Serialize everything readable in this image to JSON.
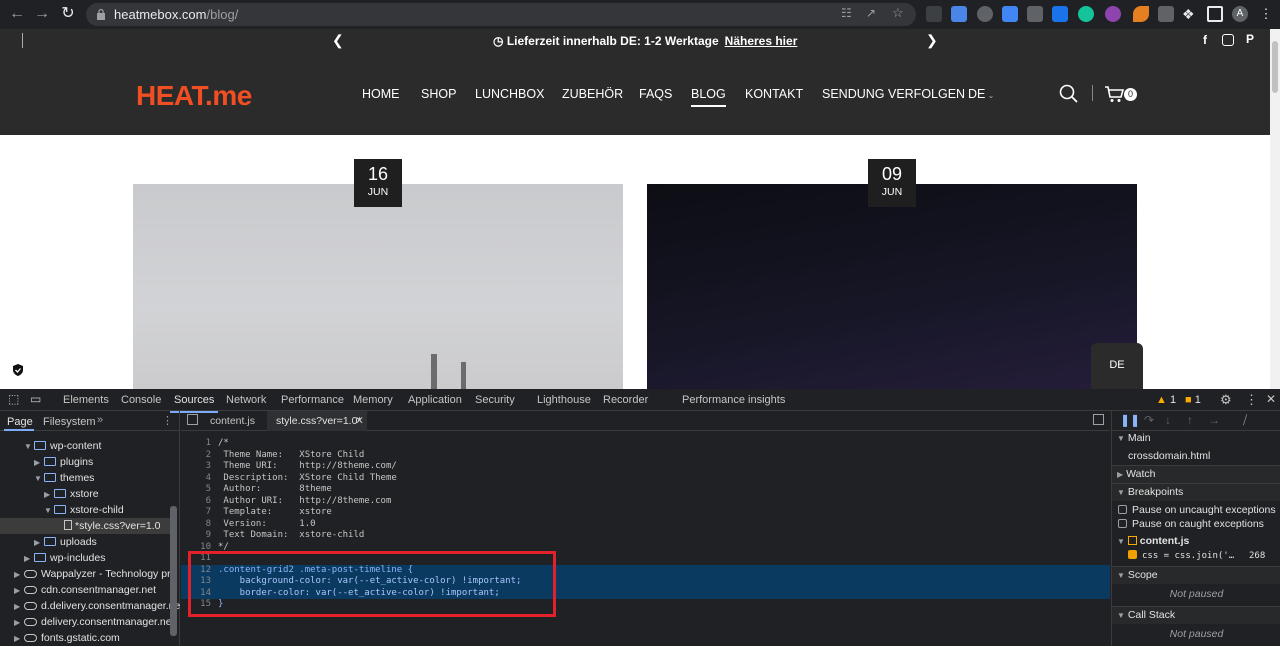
{
  "browser": {
    "url_host": "heatmebox.com",
    "url_path": "/blog/"
  },
  "site": {
    "topbar_message": "Lieferzeit innerhalb DE: 1-2 Werktage",
    "topbar_link": "Näheres hier",
    "logo": "HEAT.me",
    "nav": [
      "HOME",
      "SHOP",
      "LUNCHBOX",
      "ZUBEHÖR",
      "FAQS",
      "BLOG",
      "KONTAKT",
      "SENDUNG VERFOLGEN",
      "DE"
    ],
    "cart_count": "0",
    "posts": [
      {
        "day": "16",
        "month": "JUN"
      },
      {
        "day": "09",
        "month": "JUN"
      }
    ],
    "lang_popup": "DE"
  },
  "devtools": {
    "tabs": [
      "Elements",
      "Console",
      "Sources",
      "Network",
      "Performance",
      "Memory",
      "Application",
      "Security",
      "Lighthouse",
      "Recorder",
      "Performance insights"
    ],
    "warnings": "1",
    "issues": "1",
    "left_tabs": [
      "Page",
      "Filesystem"
    ],
    "tree": [
      {
        "label": "wp-content",
        "type": "folder"
      },
      {
        "label": "plugins",
        "type": "folder"
      },
      {
        "label": "themes",
        "type": "folder"
      },
      {
        "label": "xstore",
        "type": "folder"
      },
      {
        "label": "xstore-child",
        "type": "folder"
      },
      {
        "label": "*style.css?ver=1.0",
        "type": "file"
      },
      {
        "label": "uploads",
        "type": "folder"
      },
      {
        "label": "wp-includes",
        "type": "folder"
      },
      {
        "label": "Wappalyzer - Technology pro",
        "type": "cloud"
      },
      {
        "label": "cdn.consentmanager.net",
        "type": "cloud"
      },
      {
        "label": "d.delivery.consentmanager.ne",
        "type": "cloud"
      },
      {
        "label": "delivery.consentmanager.net",
        "type": "cloud"
      },
      {
        "label": "fonts.gstatic.com",
        "type": "cloud"
      }
    ],
    "editor_tabs": [
      "content.js",
      "style.css?ver=1.0*"
    ],
    "code": [
      "/*",
      " Theme Name:   XStore Child",
      " Theme URI:    http://8theme.com/",
      " Description:  XStore Child Theme",
      " Author:       8theme",
      " Author URI:   http://8theme.com",
      " Template:     xstore",
      " Version:      1.0",
      " Text Domain:  xstore-child",
      "*/",
      "",
      ".content-grid2 .meta-post-timeline {",
      "    background-color: var(--et_active-color) !important;",
      "    border-color: var(--et_active-color) !important;",
      "}"
    ],
    "right": {
      "thread_main": "Main",
      "thread_frame": "crossdomain.html",
      "watch": "Watch",
      "breakpoints": "Breakpoints",
      "pause_uncaught": "Pause on uncaught exceptions",
      "pause_caught": "Pause on caught exceptions",
      "bp_file": "content.js",
      "bp_code": "css = css.join('…",
      "bp_line": "268",
      "scope": "Scope",
      "not_paused": "Not paused",
      "call_stack": "Call Stack",
      "not_paused_2": "Not paused"
    }
  }
}
